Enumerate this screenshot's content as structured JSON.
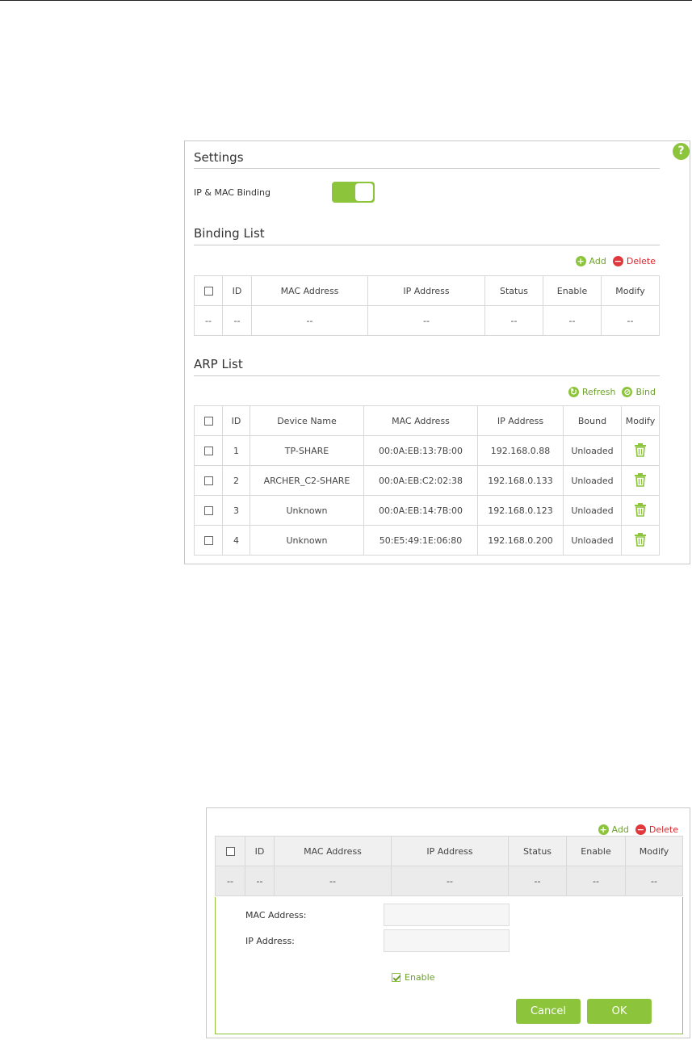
{
  "settings": {
    "title": "Settings",
    "ip_mac_binding_label": "IP & MAC Binding",
    "toggle_enabled": true,
    "help_symbol": "?"
  },
  "binding_list": {
    "title": "Binding List",
    "add_label": "Add",
    "delete_label": "Delete",
    "columns": [
      "ID",
      "MAC Address",
      "IP Address",
      "Status",
      "Enable",
      "Modify"
    ],
    "empty_cell": "--"
  },
  "arp_list": {
    "title": "ARP List",
    "refresh_label": "Refresh",
    "bind_label": "Bind",
    "columns": [
      "ID",
      "Device Name",
      "MAC Address",
      "IP Address",
      "Bound",
      "Modify"
    ],
    "rows": [
      {
        "id": "1",
        "device": "TP-SHARE",
        "mac": "00:0A:EB:13:7B:00",
        "ip": "192.168.0.88",
        "bound": "Unloaded"
      },
      {
        "id": "2",
        "device": "ARCHER_C2-SHARE",
        "mac": "00:0A:EB:C2:02:38",
        "ip": "192.168.0.133",
        "bound": "Unloaded"
      },
      {
        "id": "3",
        "device": "Unknown",
        "mac": "00:0A:EB:14:7B:00",
        "ip": "192.168.0.123",
        "bound": "Unloaded"
      },
      {
        "id": "4",
        "device": "Unknown",
        "mac": "50:E5:49:1E:06:80",
        "ip": "192.168.0.200",
        "bound": "Unloaded"
      }
    ]
  },
  "editor": {
    "add_label": "Add",
    "delete_label": "Delete",
    "columns": [
      "ID",
      "MAC Address",
      "IP Address",
      "Status",
      "Enable",
      "Modify"
    ],
    "empty_cell": "--",
    "mac_label": "MAC Address:",
    "mac_value": "",
    "ip_label": "IP Address:",
    "ip_value": "",
    "enable_label": "Enable",
    "enable_checked": true,
    "cancel_label": "Cancel",
    "ok_label": "OK"
  },
  "colors": {
    "accent_green": "#8cc43c",
    "delete_red": "#e0383c"
  },
  "icons": [
    "help-icon",
    "add-icon",
    "delete-icon",
    "refresh-icon",
    "bind-icon",
    "trash-icon",
    "checkbox-icon"
  ]
}
